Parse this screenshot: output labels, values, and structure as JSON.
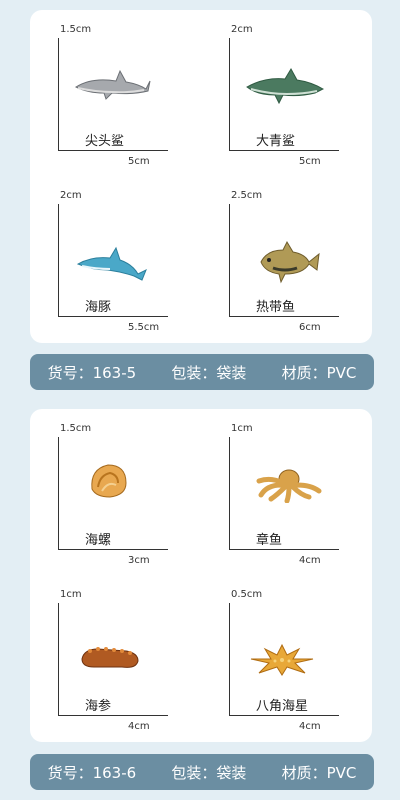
{
  "group1": {
    "items": [
      {
        "name": "尖头鲨",
        "height": "1.5cm",
        "width": "5cm",
        "icon": "shark-icon"
      },
      {
        "name": "大青鲨",
        "height": "2cm",
        "width": "5cm",
        "icon": "shark-icon"
      },
      {
        "name": "海豚",
        "height": "2cm",
        "width": "5.5cm",
        "icon": "dolphin-icon"
      },
      {
        "name": "热带鱼",
        "height": "2.5cm",
        "width": "6cm",
        "icon": "fish-icon"
      }
    ],
    "bar": {
      "model": "货号：163-5",
      "pack": "包装：袋装",
      "material": "材质：PVC"
    }
  },
  "group2": {
    "items": [
      {
        "name": "海螺",
        "height": "1.5cm",
        "width": "3cm",
        "icon": "conch-icon"
      },
      {
        "name": "章鱼",
        "height": "1cm",
        "width": "4cm",
        "icon": "octopus-icon"
      },
      {
        "name": "海参",
        "height": "1cm",
        "width": "4cm",
        "icon": "sea-cucumber-icon"
      },
      {
        "name": "八角海星",
        "height": "0.5cm",
        "width": "4cm",
        "icon": "starfish-icon"
      }
    ],
    "bar": {
      "model": "货号：163-6",
      "pack": "包装：袋装",
      "material": "材质：PVC"
    }
  }
}
